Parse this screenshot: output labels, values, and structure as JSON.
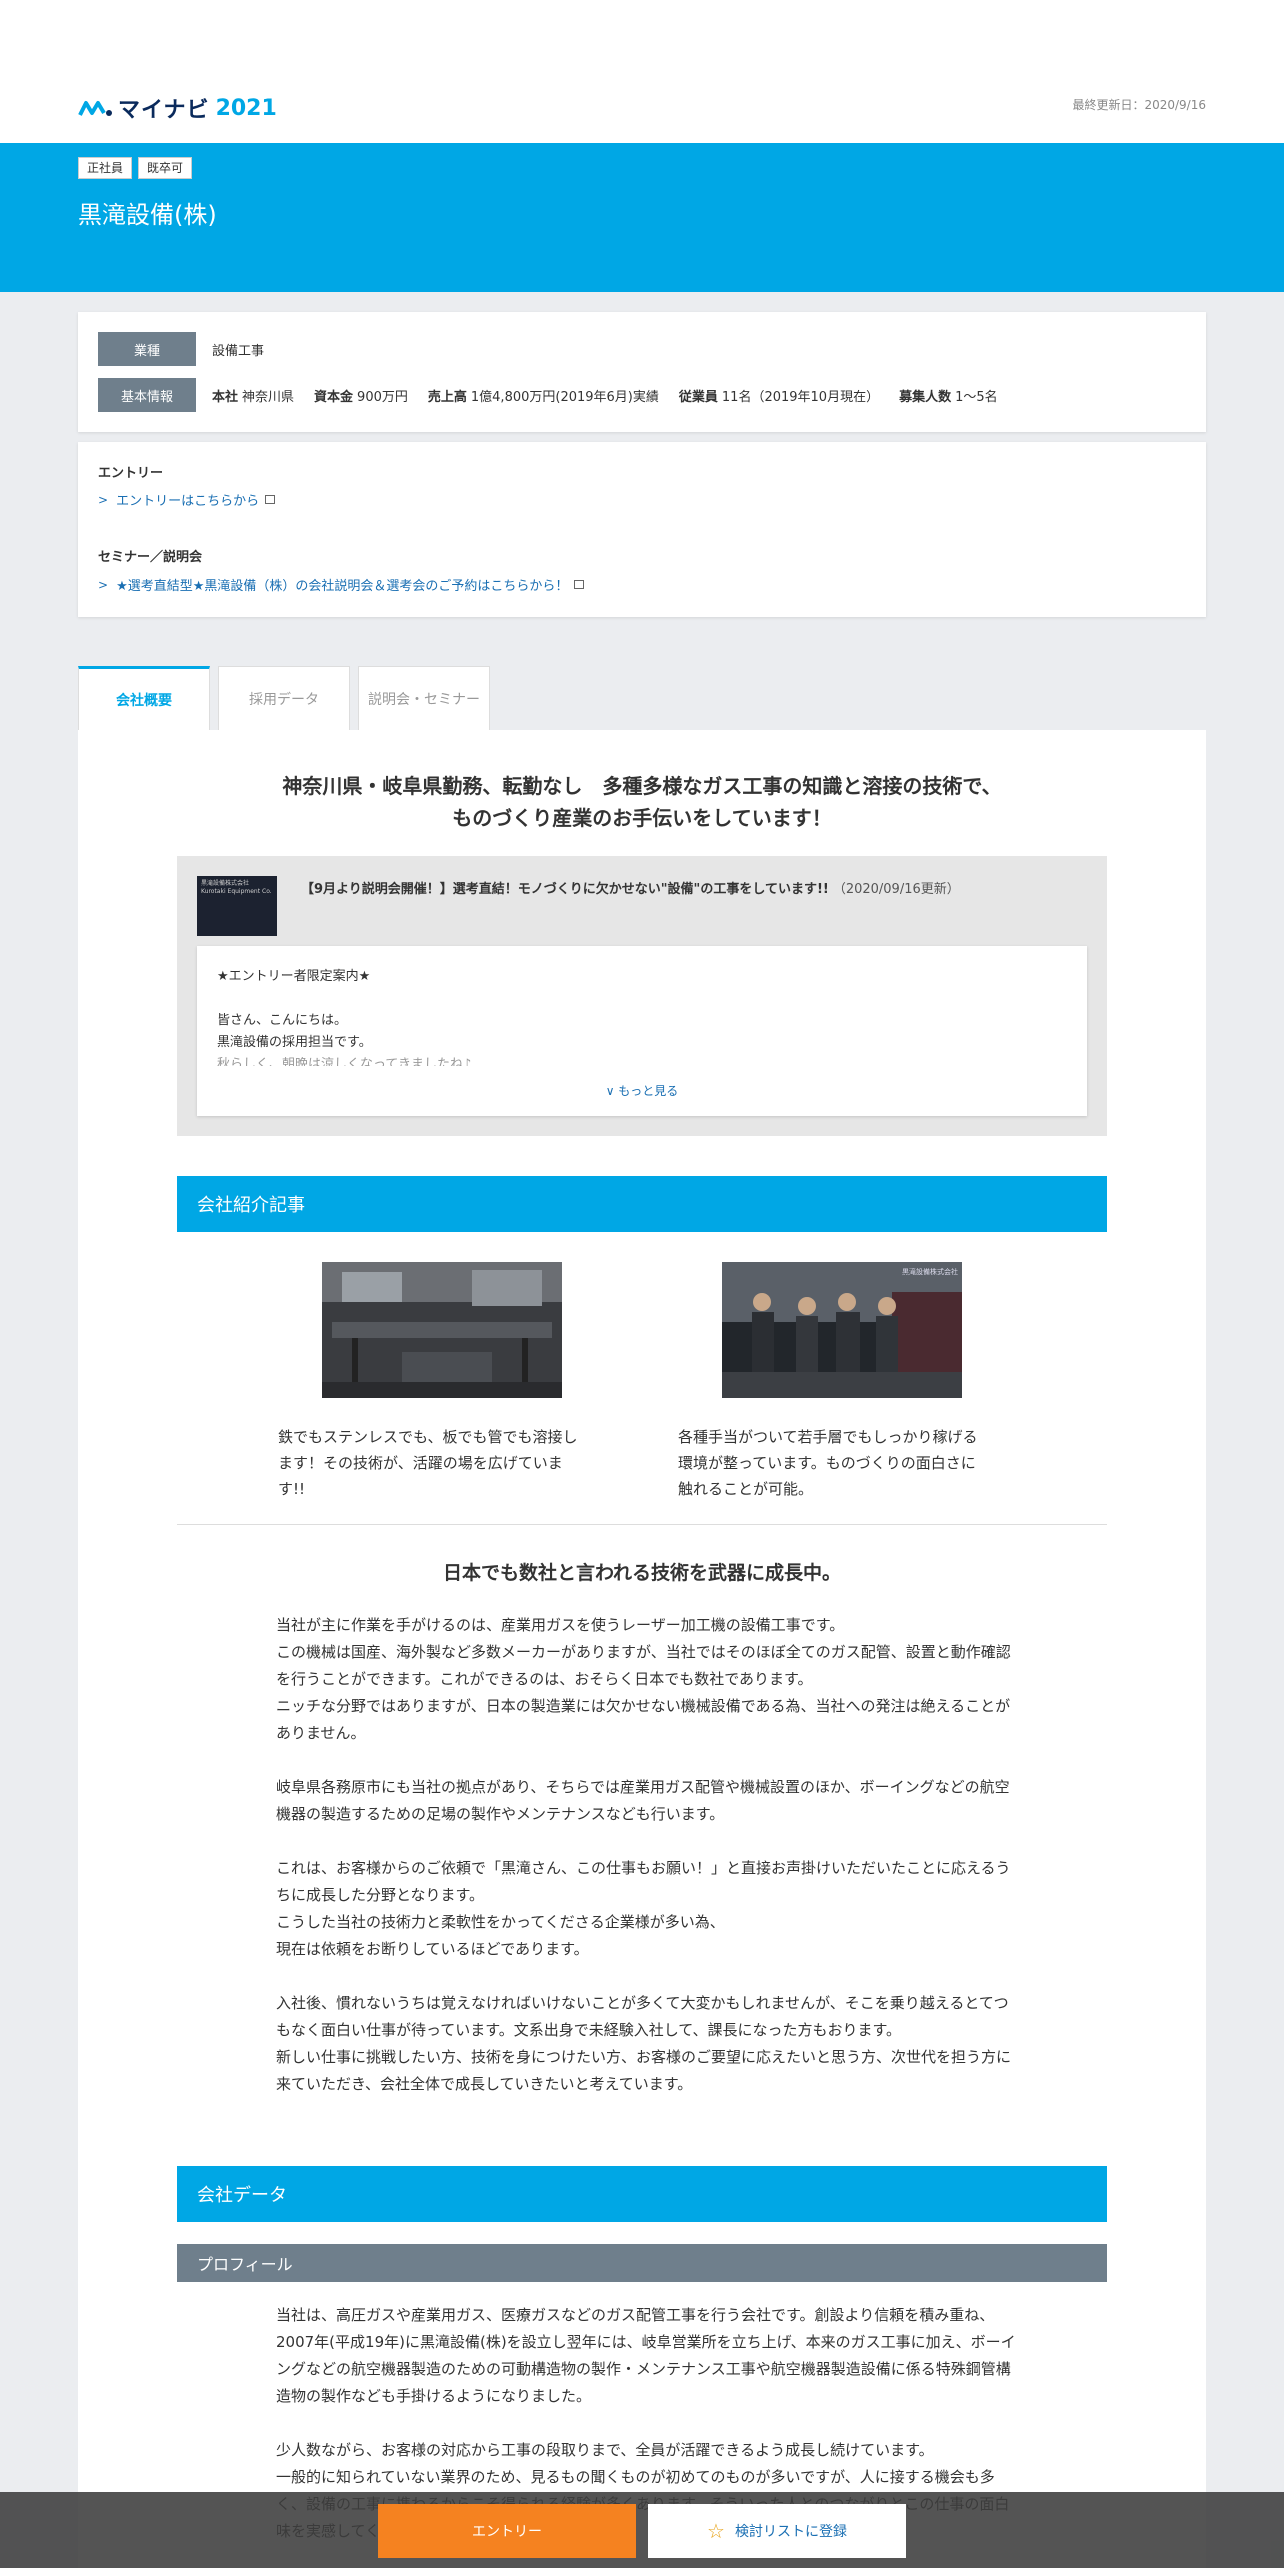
{
  "header": {
    "logo_text": "マイナビ",
    "logo_year": "2021",
    "updated": "最終更新日：2020/9/16"
  },
  "hero": {
    "badges": [
      "正社員",
      "既卒可"
    ],
    "company": "黒滝設備(株)"
  },
  "info": {
    "industry_label": "業種",
    "industry_value": "設備工事",
    "basic_label": "基本情報",
    "segments": [
      {
        "k": "本社",
        "v": "神奈川県"
      },
      {
        "k": "資本金",
        "v": "900万円"
      },
      {
        "k": "売上高",
        "v": "1億4,800万円(2019年6月)実績"
      },
      {
        "k": "従業員",
        "v": "11名（2019年10月現在）"
      },
      {
        "k": "募集人数",
        "v": "1～5名"
      }
    ]
  },
  "entry": {
    "entry_title": "エントリー",
    "entry_link": "エントリーはこちらから",
    "seminar_title": "セミナー／説明会",
    "seminar_link": "★選考直結型★黒滝設備（株）の会社説明会＆選考会のご予約はこちらから！"
  },
  "tabs": [
    "会社概要",
    "採用データ",
    "説明会・セミナー"
  ],
  "headline": [
    "神奈川県・岐阜県勤務、転勤なし　多種多様なガス工事の知識と溶接の技術で、",
    "ものづくり産業のお手伝いをしています！"
  ],
  "news": {
    "thumb_text": "黒滝設備株式会社 Kurotaki Equipment Co.",
    "title": "【9月より説明会開催！】選考直結！モノづくりに欠かせない\"設備\"の工事をしています!!",
    "date": "（2020/09/16更新）",
    "lines": [
      "★エントリー者限定案内★",
      "",
      "皆さん、こんにちは。",
      "黒滝設備の採用担当です。",
      "秋らしく、朝晩は涼しくなってきましたね♪"
    ],
    "more": "もっと見る"
  },
  "intro_band": "会社紹介記事",
  "articles": [
    {
      "text": "鉄でもステンレスでも、板でも管でも溶接します！その技術が、活躍の場を広げています!!"
    },
    {
      "text": "各種手当がついて若手層でもしっかり稼げる環境が整っています。ものづくりの面白さに触れることが可能。",
      "sign": "黒滝設備株式会社"
    }
  ],
  "subhead": "日本でも数社と言われる技術を武器に成長中。",
  "body_lines": [
    "当社が主に作業を手がけるのは、産業用ガスを使うレーザー加工機の設備工事です。",
    "この機械は国産、海外製など多数メーカーがありますが、当社ではそのほぼ全てのガス配管、設置と動作確認を行うことができます。これができるのは、おそらく日本でも数社であります。",
    "ニッチな分野ではありますが、日本の製造業には欠かせない機械設備である為、当社への発注は絶えることがありません。",
    "",
    "岐阜県各務原市にも当社の拠点があり、そちらでは産業用ガス配管や機械設置のほか、ボーイングなどの航空機器の製造するための足場の製作やメンテナンスなども行います。",
    "",
    "これは、お客様からのご依頼で「黒滝さん、この仕事もお願い！」と直接お声掛けいただいたことに応えるうちに成長した分野となります。",
    "こうした当社の技術力と柔軟性をかってくださる企業様が多い為、",
    "現在は依頼をお断りしているほどであります。",
    "",
    "入社後、慣れないうちは覚えなければいけないことが多くて大変かもしれませんが、そこを乗り越えるとてつもなく面白い仕事が待っています。文系出身で未経験入社して、課長になった方もおります。",
    "新しい仕事に挑戦したい方、技術を身につけたい方、お客様のご要望に応えたいと思う方、次世代を担う方に来ていただき、会社全体で成長していきたいと考えています。"
  ],
  "data_band": "会社データ",
  "profile_band": "プロフィール",
  "profile_lines": [
    "当社は、高圧ガスや産業用ガス、医療ガスなどのガス配管工事を行う会社です。創設より信頼を積み重ね、2007年(平成19年)に黒滝設備(株)を設立し翌年には、岐阜営業所を立ち上げ、本来のガス工事に加え、ボーイングなどの航空機器製造のための可動構造物の製作・メンテナンス工事や航空機器製造設備に係る特殊鋼管構造物の製作なども手掛けるようになりました。",
    "",
    "少人数ながら、お客様の対応から工事の段取りまで、全員が活躍できるよう成長し続けています。",
    "一般的に知られていない業界のため、見るもの聞くものが初めてのものが多いですが、人に接する機会も多く、設備の工事に携わるからこそ得られる経験が多くあります。そういった人とのつながりとこの仕事の面白味を実感してください。"
  ],
  "bottom": {
    "entry_btn": "エントリー",
    "list_btn": "検討リストに登録"
  },
  "colors": {
    "brand": "#00a7e5",
    "entry": "#f58220",
    "label_gray": "#6f7f8c",
    "link": "#1a6fb3"
  }
}
